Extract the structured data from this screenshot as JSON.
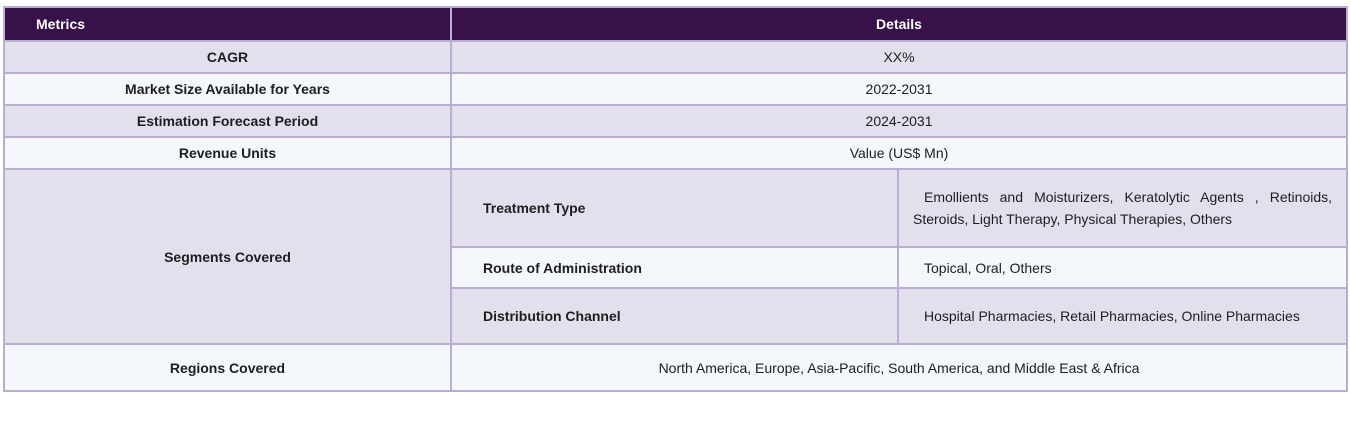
{
  "table": {
    "header": {
      "metrics": "Metrics",
      "details": "Details"
    },
    "rows": [
      {
        "metric": "CAGR",
        "value": "XX%"
      },
      {
        "metric": "Market Size Available for Years",
        "value": "2022-2031"
      },
      {
        "metric": "Estimation Forecast Period",
        "value": "2024-2031"
      },
      {
        "metric": "Revenue Units",
        "value": "Value (US$ Mn)"
      }
    ],
    "segments": {
      "metric": "Segments Covered",
      "items": [
        {
          "label": "Treatment Type",
          "value": "Emollients and Moisturizers, Keratolytic Agents , Retinoids, Steroids, Light Therapy, Physical Therapies, Others"
        },
        {
          "label": "Route of Administration",
          "value": "Topical, Oral, Others"
        },
        {
          "label": "Distribution Channel",
          "value": "Hospital Pharmacies, Retail Pharmacies, Online Pharmacies"
        }
      ]
    },
    "regions": {
      "metric": "Regions Covered",
      "value": "North America, Europe, Asia-Pacific, South America, and Middle East & Africa"
    }
  }
}
